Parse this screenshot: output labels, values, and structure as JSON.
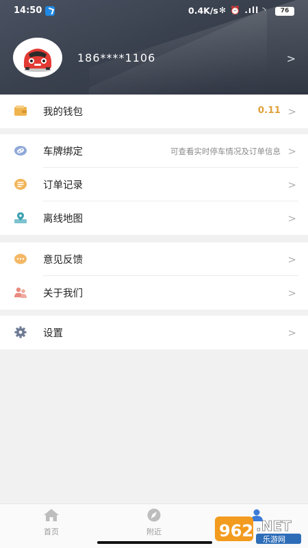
{
  "status_bar": {
    "time": "14:50",
    "network_speed": "0.4K/s",
    "indicators": "✻ ⏰ .ıll ◝",
    "battery": "76"
  },
  "profile": {
    "phone": "186****1106"
  },
  "menu_groups": [
    [
      {
        "label": "我的钱包",
        "value": "0.11",
        "icon": "wallet-icon"
      }
    ],
    [
      {
        "label": "车牌绑定",
        "hint": "可查看实时停车情况及订单信息",
        "icon": "link-icon"
      },
      {
        "label": "订单记录",
        "icon": "list-icon"
      },
      {
        "label": "离线地图",
        "icon": "map-pin-icon"
      }
    ],
    [
      {
        "label": "意见反馈",
        "icon": "chat-icon"
      },
      {
        "label": "关于我们",
        "icon": "users-icon"
      }
    ],
    [
      {
        "label": "设置",
        "icon": "gear-icon"
      }
    ]
  ],
  "bottom_nav": [
    {
      "label": "首页",
      "icon": "home-icon"
    },
    {
      "label": "附近",
      "icon": "compass-icon"
    },
    {
      "label": "",
      "icon": "user-icon"
    }
  ],
  "watermark": {
    "brand": "962.NET",
    "sub": "乐游网"
  },
  "colors": {
    "header": "#3a414e",
    "accent": "#e0a13b",
    "chevron": "#b0b0b0"
  }
}
